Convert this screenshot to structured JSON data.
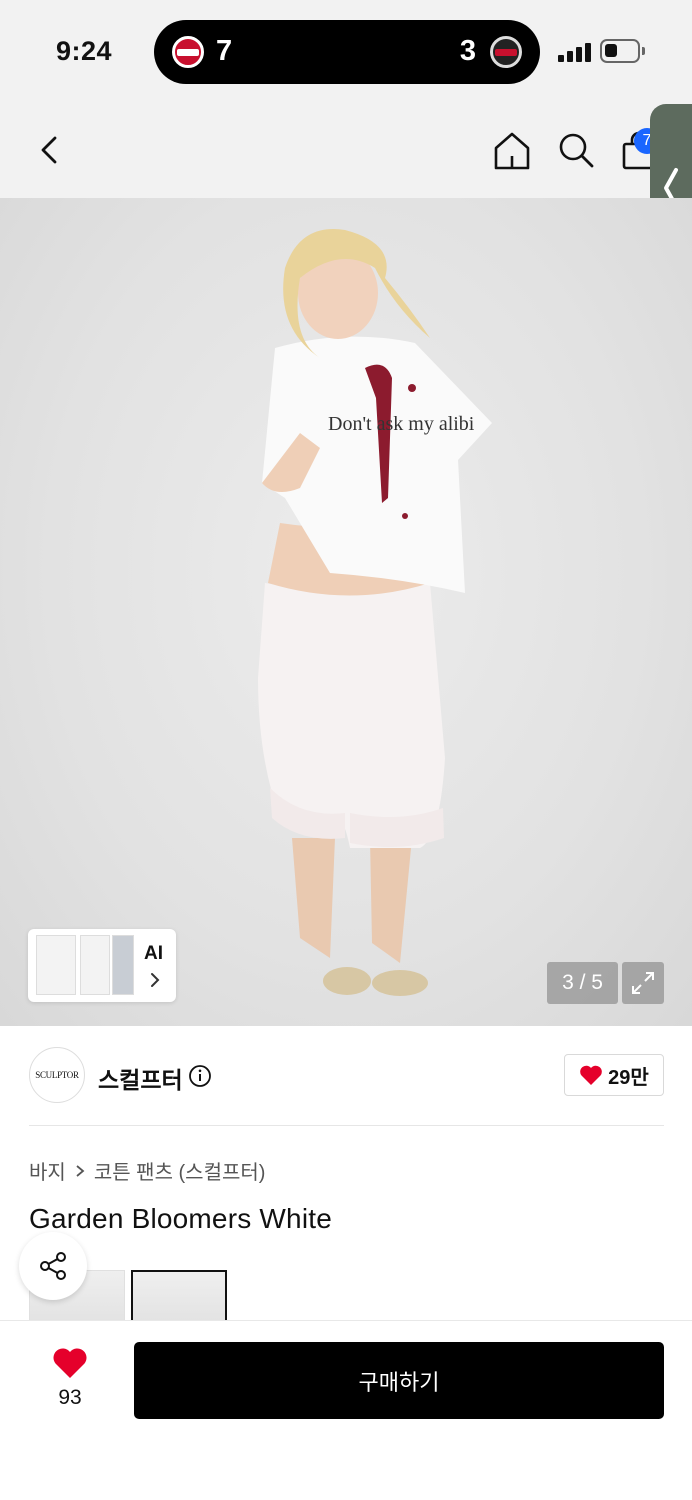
{
  "status_bar": {
    "time": "9:24",
    "live_score": {
      "home_score": "7",
      "away_score": "3",
      "home_logo": "twins-logo",
      "away_logo": "wiz-logo"
    },
    "signal_icon": "cellular-signal-icon",
    "battery_icon": "battery-icon"
  },
  "nav": {
    "back_icon": "chevron-left-icon",
    "home_icon": "home-icon",
    "search_icon": "search-icon",
    "cart_icon": "shopping-bag-icon",
    "cart_count": "7",
    "side_tab_icon": "chevron-left-icon"
  },
  "gallery": {
    "counter": "3 / 5",
    "ai_label": "AI",
    "expand_icon": "expand-icon",
    "image_text": "Don't ask my alibi"
  },
  "brand": {
    "logo_text": "SCULPTOR",
    "name": "스컬프터",
    "like_count": "29만"
  },
  "breadcrumb": {
    "category": "바지",
    "subcategory": "코튼 팬츠 (스컬프터)"
  },
  "product": {
    "title": "Garden Bloomers White"
  },
  "bottom_bar": {
    "wish_count": "93",
    "buy_label": "구매하기"
  },
  "colors": {
    "accent_red": "#e5002b",
    "badge_blue": "#1a66ff",
    "side_tab": "#5d6b5e",
    "buy_button": "#000000"
  }
}
